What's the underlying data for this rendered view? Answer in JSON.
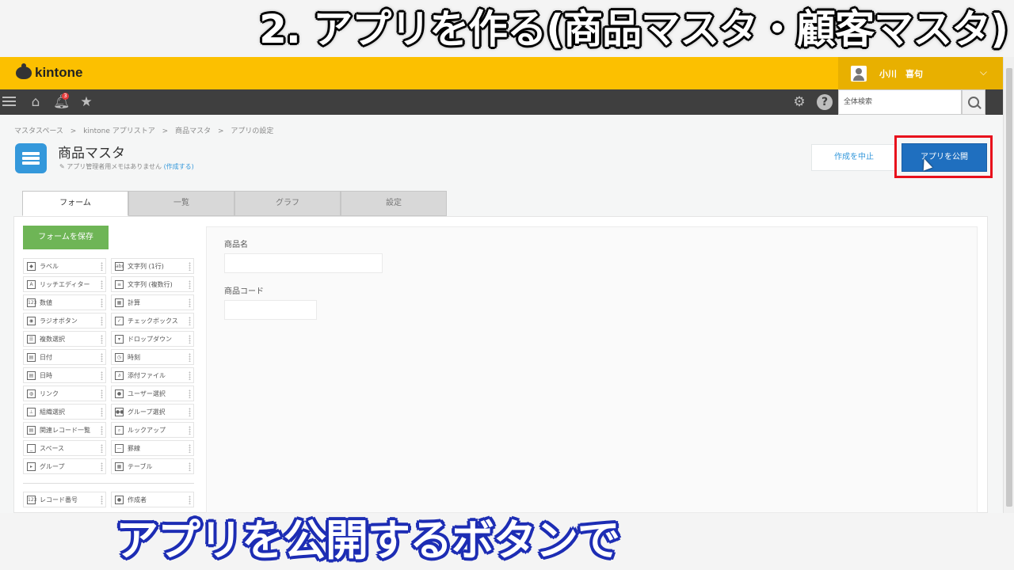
{
  "caption": {
    "top": "2. アプリを作る(商品マスタ・顧客マスタ)",
    "bottom": "アプリを公開するボタンで"
  },
  "header": {
    "logo_text": "kintone",
    "user_name": "小川　喜句",
    "notification_count": "3",
    "search_placeholder": "全体検索"
  },
  "breadcrumb": [
    "マスタスペース",
    ">",
    "kintone アプリストア",
    ">",
    "商品マスタ",
    ">",
    "アプリの設定"
  ],
  "app": {
    "title": "商品マスタ",
    "memo": "アプリ管理者用メモはありません",
    "memo_link": "(作成する)",
    "cancel_label": "作成を中止",
    "publish_label": "アプリを公開"
  },
  "tabs": [
    "フォーム",
    "一覧",
    "グラフ",
    "設定"
  ],
  "form": {
    "save_label": "フォームを保存",
    "fields": [
      {
        "label": "商品名"
      },
      {
        "label": "商品コード"
      }
    ]
  },
  "palette": [
    {
      "label": "ラベル",
      "icon": "tag-icon"
    },
    {
      "label": "文字列 (1行)",
      "icon": "abc-icon"
    },
    {
      "label": "リッチエディター",
      "icon": "rich-text-icon"
    },
    {
      "label": "文字列 (複数行)",
      "icon": "multiline-icon"
    },
    {
      "label": "数値",
      "icon": "number-icon"
    },
    {
      "label": "計算",
      "icon": "calculator-icon"
    },
    {
      "label": "ラジオボタン",
      "icon": "radio-icon"
    },
    {
      "label": "チェックボックス",
      "icon": "checkbox-icon"
    },
    {
      "label": "複数選択",
      "icon": "multi-select-icon"
    },
    {
      "label": "ドロップダウン",
      "icon": "dropdown-icon"
    },
    {
      "label": "日付",
      "icon": "calendar-icon"
    },
    {
      "label": "時刻",
      "icon": "clock-icon"
    },
    {
      "label": "日時",
      "icon": "datetime-icon"
    },
    {
      "label": "添付ファイル",
      "icon": "paperclip-icon"
    },
    {
      "label": "リンク",
      "icon": "globe-icon"
    },
    {
      "label": "ユーザー選択",
      "icon": "user-icon"
    },
    {
      "label": "組織選択",
      "icon": "org-icon"
    },
    {
      "label": "グループ選択",
      "icon": "group-icon"
    },
    {
      "label": "関連レコード一覧",
      "icon": "related-records-icon"
    },
    {
      "label": "ルックアップ",
      "icon": "lookup-icon"
    },
    {
      "label": "スペース",
      "icon": "space-icon"
    },
    {
      "label": "罫線",
      "icon": "line-icon"
    },
    {
      "label": "グループ",
      "icon": "folder-group-icon"
    },
    {
      "label": "テーブル",
      "icon": "table-icon"
    }
  ],
  "palette_system": [
    {
      "label": "レコード番号",
      "icon": "record-number-icon"
    },
    {
      "label": "作成者",
      "icon": "creator-icon"
    }
  ],
  "colors": {
    "header": "#fcc000",
    "nav": "#3f3f3f",
    "publish": "#1f6fbf",
    "save": "#6eb556",
    "highlight": "#e8101c"
  }
}
